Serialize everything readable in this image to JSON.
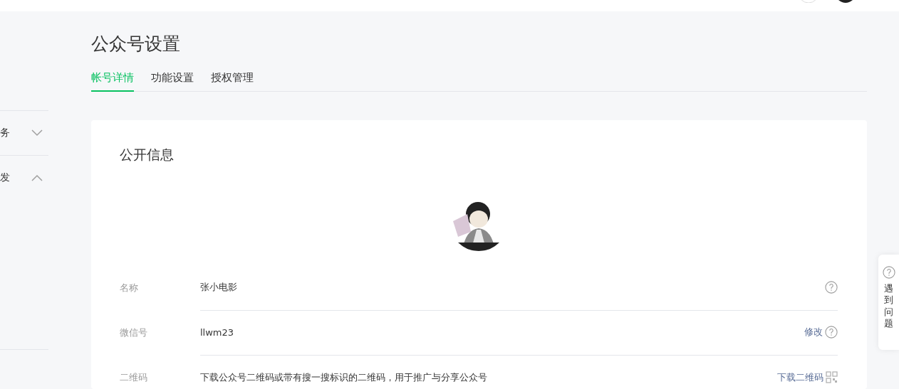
{
  "sidebar": {
    "items": [
      {
        "label": "务",
        "expanded": false
      },
      {
        "label": "发",
        "expanded": true
      }
    ]
  },
  "page": {
    "title": "公众号设置"
  },
  "tabs": [
    {
      "label": "帐号详情",
      "selected": true
    },
    {
      "label": "功能设置",
      "selected": false
    },
    {
      "label": "授权管理",
      "selected": false
    }
  ],
  "card": {
    "title": "公开信息",
    "rows": [
      {
        "label": "名称",
        "value": "张小电影",
        "action": null,
        "kind": "help"
      },
      {
        "label": "微信号",
        "value": "llwm23",
        "action": "修改",
        "kind": "help"
      },
      {
        "label": "二维码",
        "value": "下载公众号二维码或带有搜一搜标识的二维码，用于推广与分享公众号",
        "action": "下载二维码",
        "kind": "qr"
      }
    ]
  },
  "help_widget": {
    "text": "遇到问题"
  }
}
